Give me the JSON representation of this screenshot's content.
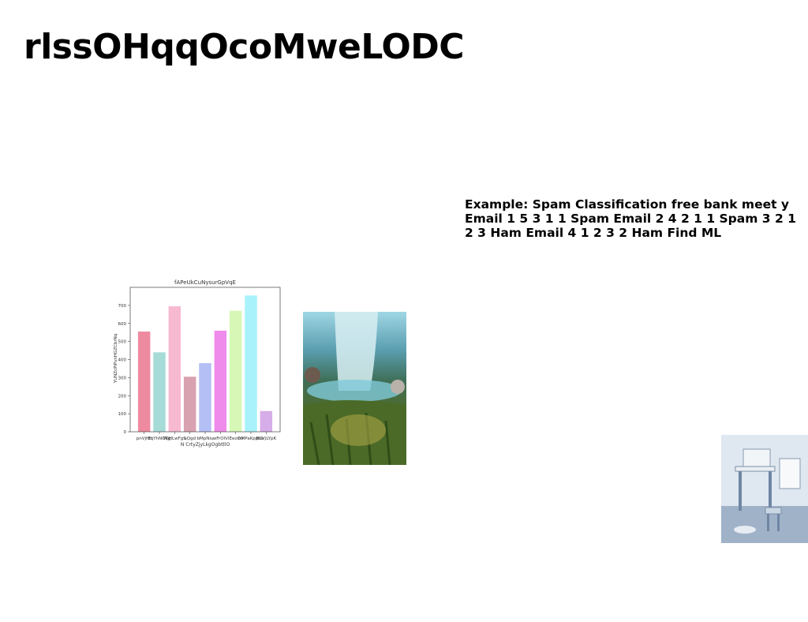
{
  "slide": {
    "title": "rlssOHqqOcoMweLODC",
    "body": "Example: Spam Classification free bank meet y Email 1 5 3 1 1 Spam Email 2 4 2 1 1 Spam 3 2 1 2 3 Ham Email 4 1 2 3 2 Ham Find ML"
  },
  "chart_data": {
    "type": "bar",
    "title": "fAPeUkCuNysurGpVqE",
    "xlabel": "N CrtyZjyLkgOgbttlO",
    "ylabel": "YUNZcPiPvnHGZCbrNq",
    "categories": [
      "pnVjfdt",
      "EqYhNOKg",
      "WjHLwFgS",
      "uQgd",
      "bMpNiu",
      "wFrOlV",
      "lEeoOv",
      "hMPaKpptw",
      "BCVjLYpK"
    ],
    "values": [
      555,
      440,
      695,
      305,
      380,
      560,
      670,
      755,
      115
    ],
    "colors": [
      "#ee8aa0",
      "#a6dbd8",
      "#f7b9d0",
      "#d9a2b0",
      "#b3bff5",
      "#ef8bea",
      "#d6f7b6",
      "#a9f2fb",
      "#d6ade8"
    ],
    "yticks": [
      0,
      100,
      200,
      300,
      400,
      500,
      600,
      700
    ],
    "ylim": [
      0,
      800
    ],
    "grid": false
  },
  "images": {
    "waterfall": "waterfall-landscape-photo",
    "room": "study-room-photo"
  }
}
